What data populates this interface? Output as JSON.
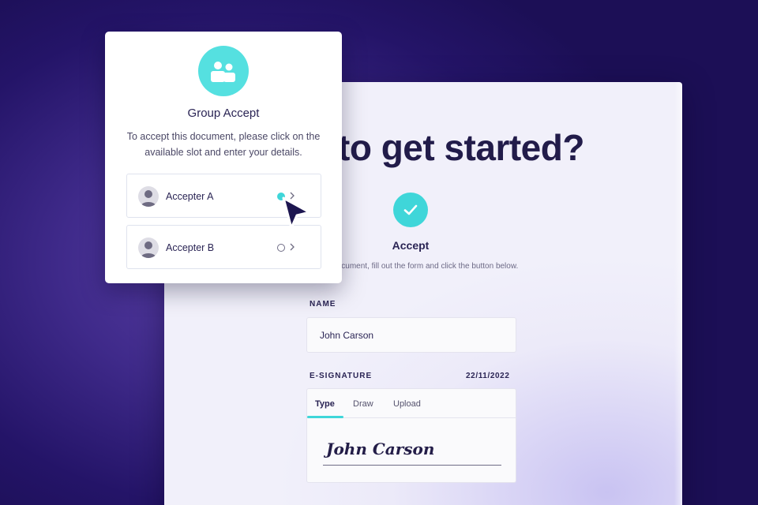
{
  "document": {
    "headline": "to get started?",
    "accept_title": "Accept",
    "accept_description": "pt this document, fill out the form and click the button below.",
    "name_label": "NAME",
    "name_value": "John Carson",
    "esignature_label": "E-SIGNATURE",
    "date": "22/11/2022",
    "signature_tabs": [
      "Type",
      "Draw",
      "Upload"
    ],
    "active_tab": "Type",
    "signature_text": "John Carson"
  },
  "group_accept": {
    "title": "Group Accept",
    "description": "To accept this document, please click on the available slot and enter your details.",
    "slots": [
      {
        "label": "Accepter A",
        "selected": true
      },
      {
        "label": "Accepter B",
        "selected": false
      }
    ],
    "icon": "group-users-icon"
  },
  "colors": {
    "accent": "#3fd6d9",
    "text_dark": "#221c4a",
    "background_purple": "#3f2a8a"
  }
}
